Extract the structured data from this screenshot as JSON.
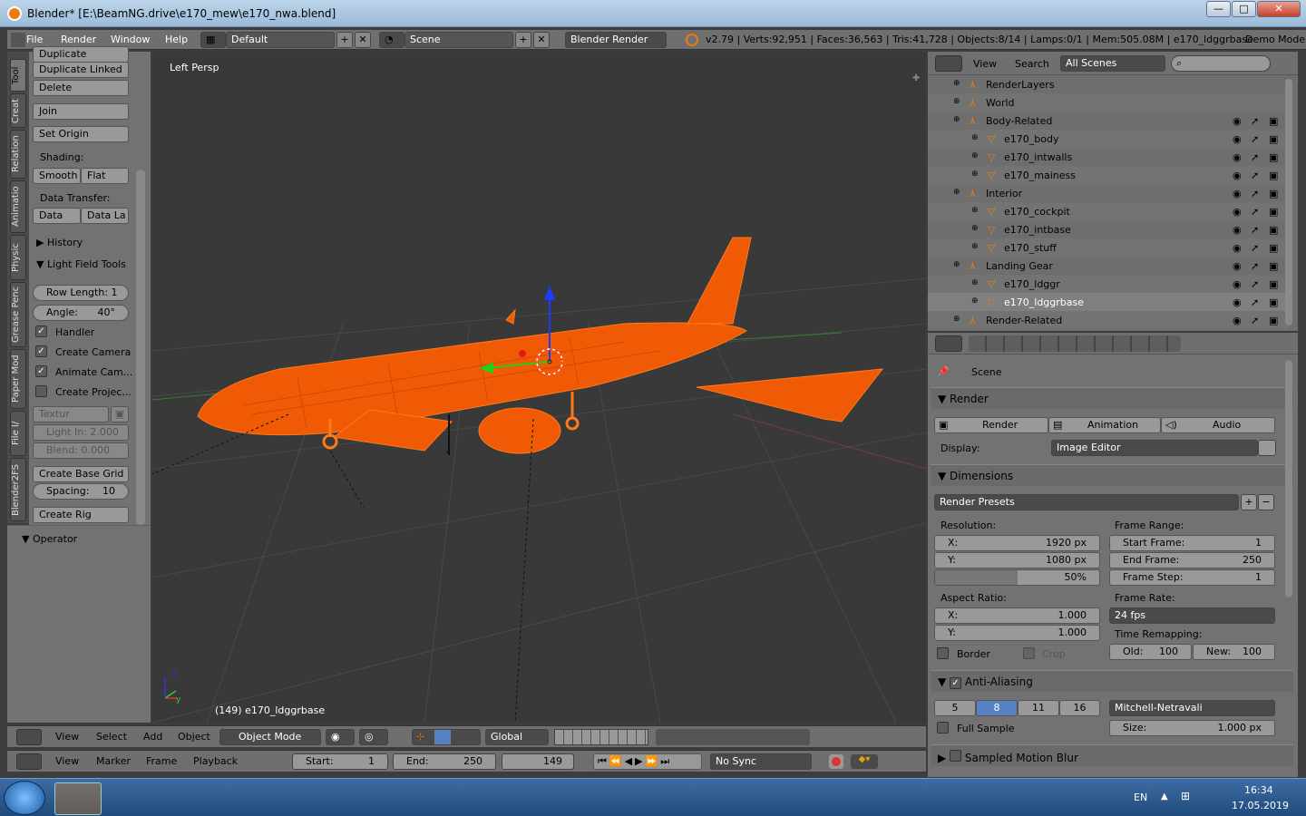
{
  "window": {
    "title": "Blender* [E:\\BeamNG.drive\\e170_mew\\e170_nwa.blend]",
    "min": "—",
    "max": "□",
    "close": "✕"
  },
  "topbar": {
    "menus": [
      "File",
      "Render",
      "Window",
      "Help"
    ],
    "layout": "Default",
    "scene": "Scene",
    "engine": "Blender Render",
    "stats": "v2.79 | Verts:92,951 | Faces:36,563 | Tris:41,728 | Objects:8/14 | Lamps:0/1 | Mem:505.08M | e170_ldggrbase",
    "demo": "Demo Mode"
  },
  "tabs": [
    "Tool",
    "Creat",
    "Relation",
    "Animatio",
    "Physic",
    "Grease Penc",
    "Paper Mod",
    "File I/",
    "Blender2FS"
  ],
  "shelf": {
    "duplicate": "Duplicate",
    "duplicate_linked": "Duplicate Linked",
    "delete": "Delete",
    "join": "Join",
    "set_origin": "Set Origin",
    "shading_label": "Shading:",
    "smooth": "Smooth",
    "flat": "Flat",
    "data_transfer_label": "Data Transfer:",
    "data": "Data",
    "data_la": "Data La",
    "history": "History",
    "light_field": "Light Field Tools",
    "row_length_label": "Row Length:",
    "row_length_value": "1",
    "angle_label": "Angle:",
    "angle_value": "40°",
    "handler": "Handler",
    "create_camera": "Create Camera",
    "animate_cam": "Animate Cam...",
    "create_projec": "Create Projec...",
    "textur": "Textur",
    "light_in": "Light In: 2.000",
    "blend": "Blend:   0.000",
    "create_base_grid": "Create Base Grid",
    "spacing_label": "Spacing:",
    "spacing_value": "10",
    "create_rig": "Create Rig",
    "operator": "Operator"
  },
  "viewport": {
    "label": "Left Persp",
    "object_info": "(149) e170_ldggrbase"
  },
  "view_header": {
    "menus": [
      "View",
      "Select",
      "Add",
      "Object"
    ],
    "mode": "Object Mode",
    "orientation": "Global"
  },
  "timeline": {
    "menus": [
      "View",
      "Marker",
      "Frame",
      "Playback"
    ],
    "start_label": "Start:",
    "start": "1",
    "end_label": "End:",
    "end": "250",
    "current": "149",
    "sync": "No Sync"
  },
  "outliner": {
    "menus": [
      "View",
      "Search"
    ],
    "filter": "All Scenes",
    "rows": [
      {
        "name": "RenderLayers",
        "indent": 1
      },
      {
        "name": "World",
        "indent": 1
      },
      {
        "name": "Body-Related",
        "indent": 1
      },
      {
        "name": "e170_body",
        "indent": 2
      },
      {
        "name": "e170_intwalls",
        "indent": 2
      },
      {
        "name": "e170_mainess",
        "indent": 2
      },
      {
        "name": "Interior",
        "indent": 1
      },
      {
        "name": "e170_cockpit",
        "indent": 2
      },
      {
        "name": "e170_intbase",
        "indent": 2
      },
      {
        "name": "e170_stuff",
        "indent": 2
      },
      {
        "name": "Landing Gear",
        "indent": 1
      },
      {
        "name": "e170_ldggr",
        "indent": 2
      },
      {
        "name": "e170_ldggrbase",
        "indent": 2
      },
      {
        "name": "Render-Related",
        "indent": 1
      }
    ]
  },
  "props": {
    "scene": "Scene",
    "render_section": "Render",
    "render_btn": "Render",
    "animation_btn": "Animation",
    "audio_btn": "Audio",
    "display_label": "Display:",
    "display_value": "Image Editor",
    "dimensions": "Dimensions",
    "render_presets": "Render Presets",
    "resolution_label": "Resolution:",
    "res_x_label": "X:",
    "res_x": "1920 px",
    "res_y_label": "Y:",
    "res_y": "1080 px",
    "res_pct": "50%",
    "res_pct_value": 0.5,
    "frame_range_label": "Frame Range:",
    "start_frame_label": "Start Frame:",
    "start_frame": "1",
    "end_frame_label": "End Frame:",
    "end_frame": "250",
    "frame_step_label": "Frame Step:",
    "frame_step": "1",
    "aspect_label": "Aspect Ratio:",
    "asp_x_label": "X:",
    "asp_x": "1.000",
    "asp_y_label": "Y:",
    "asp_y": "1.000",
    "frame_rate_label": "Frame Rate:",
    "frame_rate": "24 fps",
    "time_remap_label": "Time Remapping:",
    "old_label": "Old:",
    "old": "100",
    "new_label": "New:",
    "new": "100",
    "border": "Border",
    "crop": "Crop",
    "anti_aliasing": "Anti-Aliasing",
    "aa_samples": [
      "5",
      "8",
      "11",
      "16"
    ],
    "aa_filter": "Mitchell-Netravali",
    "full_sample": "Full Sample",
    "size_label": "Size:",
    "size_value": "1.000 px",
    "motion_blur": "Sampled Motion Blur"
  },
  "taskbar": {
    "lang": "EN",
    "time": "16:34",
    "date": "17.05.2019"
  }
}
